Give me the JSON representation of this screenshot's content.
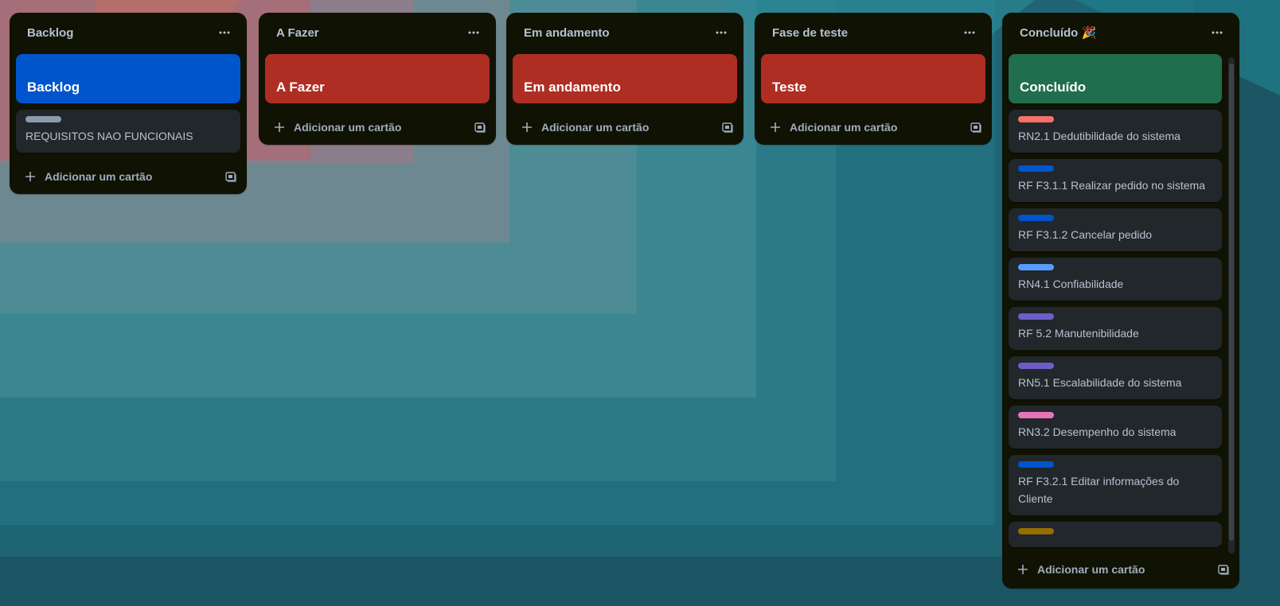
{
  "lists": [
    {
      "title": "Backlog",
      "cover": {
        "title": "Backlog",
        "color": "#0055cc"
      },
      "cards": [
        {
          "title": "REQUISITOS NAO FUNCIONAIS",
          "label_color": "#8c9bab"
        }
      ],
      "add_label": "Adicionar um cartão"
    },
    {
      "title": "A Fazer",
      "cover": {
        "title": "A Fazer",
        "color": "#ae2e24"
      },
      "cards": [],
      "add_label": "Adicionar um cartão"
    },
    {
      "title": "Em andamento",
      "cover": {
        "title": "Em andamento",
        "color": "#ae2e24"
      },
      "cards": [],
      "add_label": "Adicionar um cartão"
    },
    {
      "title": "Fase de teste",
      "cover": {
        "title": "Teste",
        "color": "#ae2e24"
      },
      "cards": [],
      "add_label": "Adicionar um cartão"
    },
    {
      "title": "Concluído 🎉",
      "cover": {
        "title": "Concluído",
        "color": "#216e4e"
      },
      "cards": [
        {
          "title": "RN2.1 Dedutibilidade do sistema",
          "label_color": "#f87168"
        },
        {
          "title": "RF F3.1.1 Realizar pedido no sistema",
          "label_color": "#0055cc"
        },
        {
          "title": "RF F3.1.2 Cancelar pedido",
          "label_color": "#0055cc"
        },
        {
          "title": "RN4.1 Confiabilidade",
          "label_color": "#579dff"
        },
        {
          "title": "RF 5.2 Manutenibilidade",
          "label_color": "#6e5dc6"
        },
        {
          "title": "RN5.1 Escalabilidade do sistema",
          "label_color": "#6e5dc6"
        },
        {
          "title": "RN3.2 Desempenho do sistema",
          "label_color": "#e774bb"
        },
        {
          "title": "RF F3.2.1 Editar informações do Cliente",
          "label_color": "#0055cc"
        },
        {
          "title": "",
          "label_color": "#946f00"
        }
      ],
      "add_label": "Adicionar um cartão"
    }
  ],
  "icons": {
    "menu": "ellipsis-icon",
    "add": "plus-icon",
    "template": "card-template-icon"
  }
}
